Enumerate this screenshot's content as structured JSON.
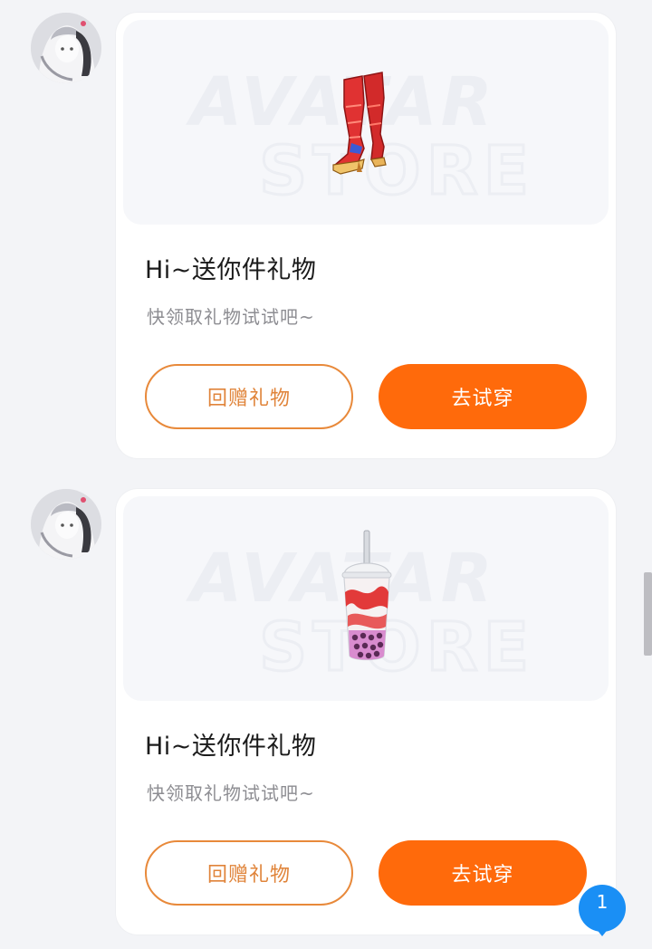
{
  "messages": [
    {
      "avatar_icon": "user-avatar",
      "item_icon": "red-boots-icon",
      "watermark_line1": "AVATAR",
      "watermark_line2": "STORE",
      "title": "Hi~送你件礼物",
      "subtitle": "快领取礼物试试吧~",
      "return_gift_label": "回赠礼物",
      "try_on_label": "去试穿"
    },
    {
      "avatar_icon": "user-avatar",
      "item_icon": "bubble-tea-cup-icon",
      "watermark_line1": "AVATAR",
      "watermark_line2": "STORE",
      "title": "Hi~送你件礼物",
      "subtitle": "快领取礼物试试吧~",
      "return_gift_label": "回赠礼物",
      "try_on_label": "去试穿"
    }
  ],
  "unread_badge": {
    "count": "1",
    "color": "#1a8ff5"
  },
  "colors": {
    "accent": "#ff6a0b",
    "accent_outline": "#e8893a"
  }
}
